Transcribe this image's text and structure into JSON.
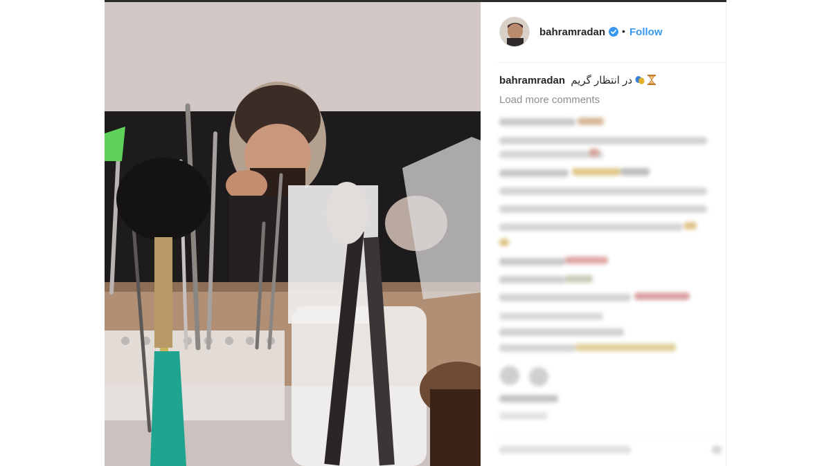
{
  "photo": {
    "alt_icon": "post-photo",
    "colors": {
      "wall": "#cfc6c1",
      "wood": "#b08f74",
      "cup": "#f4f3f4",
      "accent": "#1fa58f"
    }
  },
  "header": {
    "username": "bahramradan",
    "separator": "•",
    "follow_label": "Follow",
    "verified_icon": "verified-badge-icon"
  },
  "caption": {
    "username": "bahramradan",
    "text": "در انتظار گریم",
    "emoji_icons": [
      "theater-masks-icon",
      "hourglass-icon"
    ]
  },
  "comments": {
    "load_more_label": "Load more comments"
  },
  "colors": {
    "follow": "#3897f0",
    "text": "#262626",
    "muted": "#8e8e8e",
    "divider": "#efefef"
  }
}
